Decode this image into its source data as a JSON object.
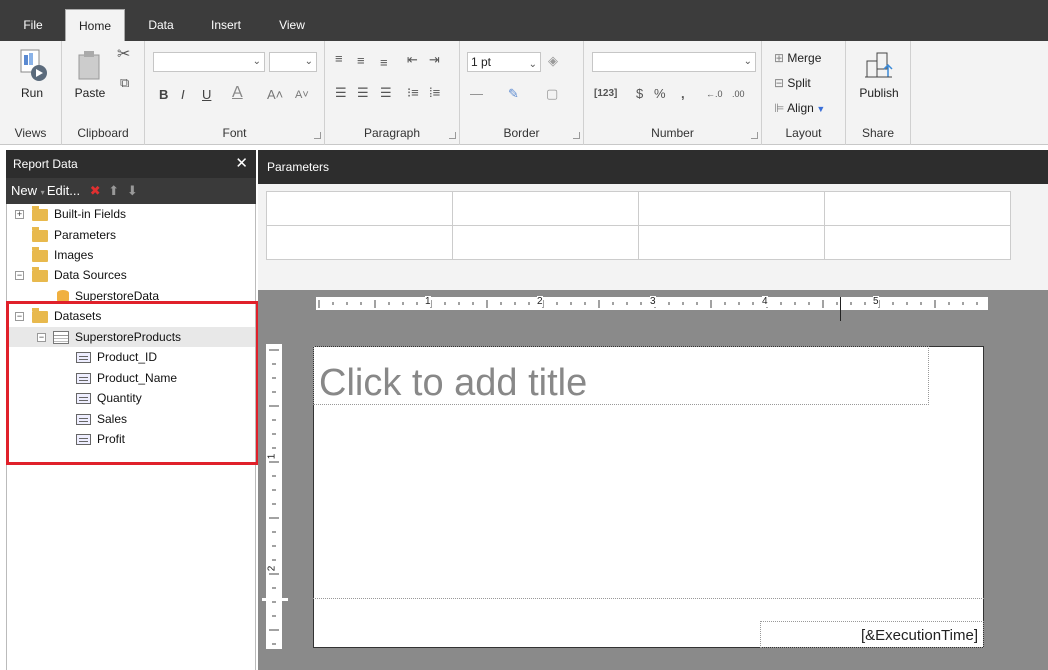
{
  "tabs": [
    {
      "label": "File"
    },
    {
      "label": "Home"
    },
    {
      "label": "Data"
    },
    {
      "label": "Insert"
    },
    {
      "label": "View"
    }
  ],
  "ribbon": {
    "views": {
      "run_label": "Run",
      "group": "Views"
    },
    "clipboard": {
      "paste_label": "Paste",
      "group": "Clipboard"
    },
    "font": {
      "group": "Font"
    },
    "paragraph": {
      "group": "Paragraph"
    },
    "border": {
      "width_value": "1 pt",
      "group": "Border"
    },
    "number": {
      "group": "Number"
    },
    "layout": {
      "merge_label": "Merge",
      "split_label": "Split",
      "align_label": "Align",
      "group": "Layout"
    },
    "share": {
      "publish_label": "Publish",
      "group": "Share"
    }
  },
  "report_data": {
    "title": "Report Data",
    "new_label": "New",
    "edit_label": "Edit...",
    "tree": {
      "builtin": "Built-in Fields",
      "parameters": "Parameters",
      "images": "Images",
      "datasources": "Data Sources",
      "datasource_item": "SuperstoreData",
      "datasets": "Datasets",
      "dataset_name": "SuperstoreProducts",
      "fields": [
        "Product_ID",
        "Product_Name",
        "Quantity",
        "Sales",
        "Profit"
      ]
    }
  },
  "parameters_pane": {
    "title": "Parameters"
  },
  "design": {
    "title_placeholder": "Click to add title",
    "execution_time": "[&ExecutionTime]",
    "ruler_numbers": [
      "1",
      "2",
      "3",
      "4",
      "5"
    ],
    "vruler_numbers": [
      "1",
      "2"
    ]
  }
}
